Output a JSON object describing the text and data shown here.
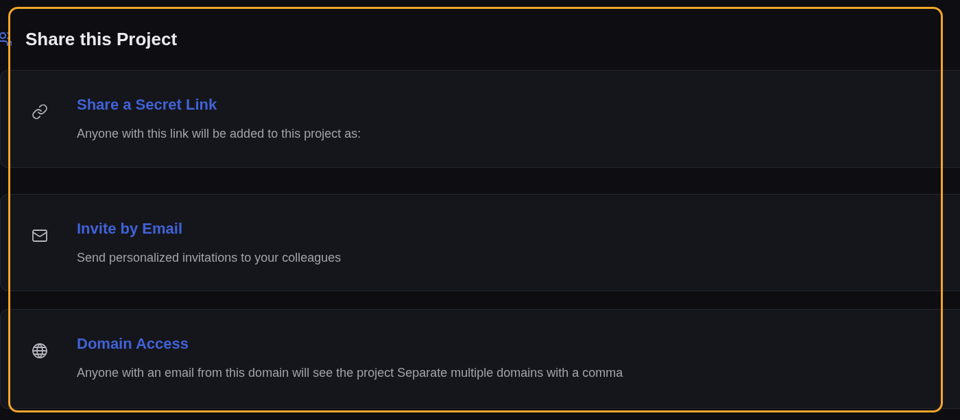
{
  "header": {
    "title": "Share this Project"
  },
  "options": [
    {
      "kind": "link",
      "title": "Share a Secret Link",
      "description": "Anyone with this link will be added to this project as:"
    },
    {
      "kind": "email",
      "title": "Invite by Email",
      "description": "Send personalized invitations to your colleagues"
    },
    {
      "kind": "domain",
      "title": "Domain Access",
      "description": "Anyone with an email from this domain will see the project Separate multiple domains with a comma"
    }
  ]
}
